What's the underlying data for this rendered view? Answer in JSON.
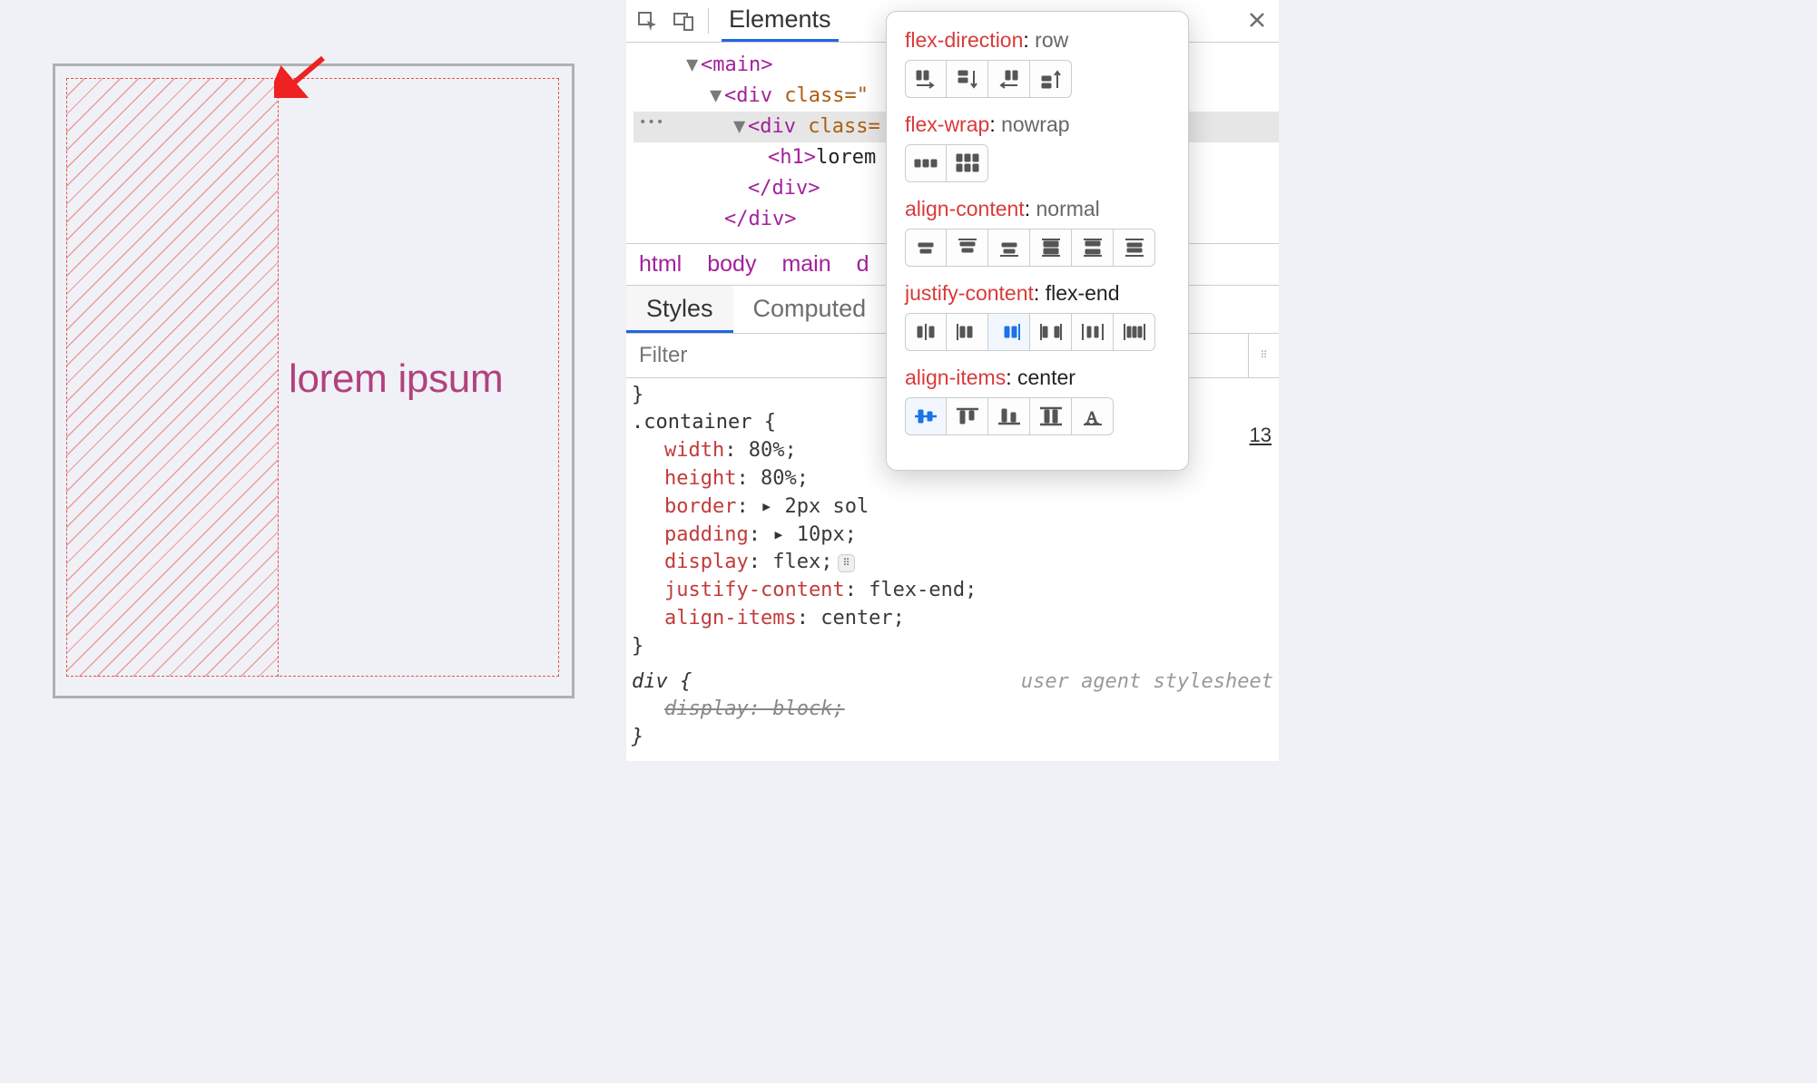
{
  "stage": {
    "heading": "lorem ipsum"
  },
  "devtools": {
    "tab_elements": "Elements",
    "tree": {
      "main_open": "<main>",
      "div1_open": "<div",
      "div1_class": " class=\"",
      "div2_open": "<div",
      "div2_class": " class=",
      "h1_open": "<h1>",
      "h1_text": "lorem",
      "div_close": "</div>",
      "div_close2": "</div>"
    },
    "crumbs": {
      "html": "html",
      "body": "body",
      "main": "main",
      "d": "d"
    },
    "styles_tab": "Styles",
    "computed_tab": "Computed",
    "filter_placeholder": "Filter",
    "source_line": "13",
    "rule": {
      "selector": ".container {",
      "decls": [
        {
          "p": "width",
          "v": "80%;"
        },
        {
          "p": "height",
          "v": "80%;"
        },
        {
          "p": "border",
          "v": "2px sol",
          "expand": true
        },
        {
          "p": "padding",
          "v": "10px;",
          "expand": true
        },
        {
          "p": "display",
          "v": "flex;",
          "badge": true
        },
        {
          "p": "justify-content",
          "v": "flex-end;"
        },
        {
          "p": "align-items",
          "v": "center;"
        }
      ],
      "close": "}"
    },
    "uarule": {
      "selector": "div {",
      "decl": "display: block;",
      "close": "}",
      "note": "user agent stylesheet"
    }
  },
  "popover": {
    "rows": [
      {
        "prop": "flex-direction",
        "val": "row",
        "opts": 4
      },
      {
        "prop": "flex-wrap",
        "val": "nowrap",
        "opts": 2
      },
      {
        "prop": "align-content",
        "val": "normal",
        "opts": 6
      },
      {
        "prop": "justify-content",
        "val": "flex-end",
        "valcolor": "k",
        "opts": 6,
        "sel": 2
      },
      {
        "prop": "align-items",
        "val": "center",
        "valcolor": "k",
        "opts": 5,
        "sel": 0
      }
    ]
  }
}
